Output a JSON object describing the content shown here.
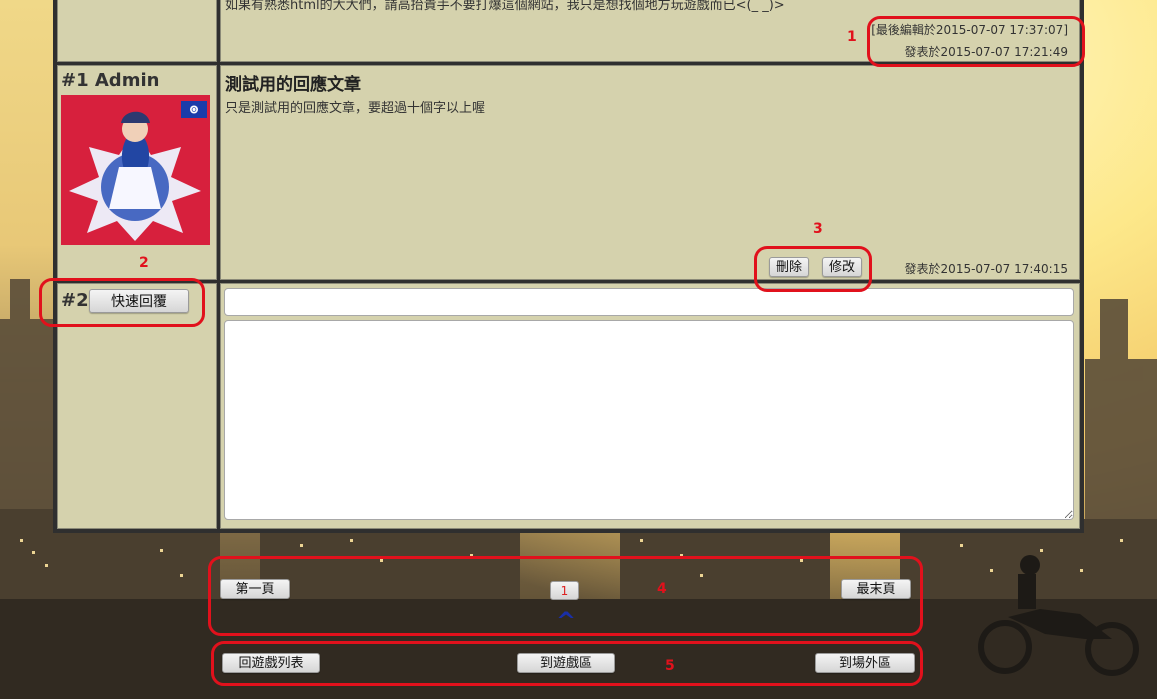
{
  "post0": {
    "content": "如果有熟悉html的大大們，請高抬貴手不要打爆這個網站，我只是想找個地方玩遊戲而已<(_ _)>",
    "edited": "[最後編輯於2015-07-07 17:37:07]",
    "posted": "發表於2015-07-07 17:21:49"
  },
  "post1": {
    "user": "#1 Admin",
    "title": "測試用的回應文章",
    "body": "只是測試用的回應文章，要超過十個字以上喔",
    "posted": "發表於2015-07-07 17:40:15",
    "delete_label": "刪除",
    "edit_label": "修改"
  },
  "reply": {
    "index": "#2",
    "quick_reply_label": "快速回覆",
    "title_value": "",
    "body_value": ""
  },
  "pagination": {
    "first_label": "第一頁",
    "current_page": "1",
    "last_label": "最末頁",
    "top_arrow": "^"
  },
  "footer_nav": {
    "back_list_label": "回遊戲列表",
    "game_area_label": "到遊戲區",
    "outside_area_label": "到場外區"
  },
  "annotations": [
    "1",
    "2",
    "3",
    "4",
    "5"
  ]
}
